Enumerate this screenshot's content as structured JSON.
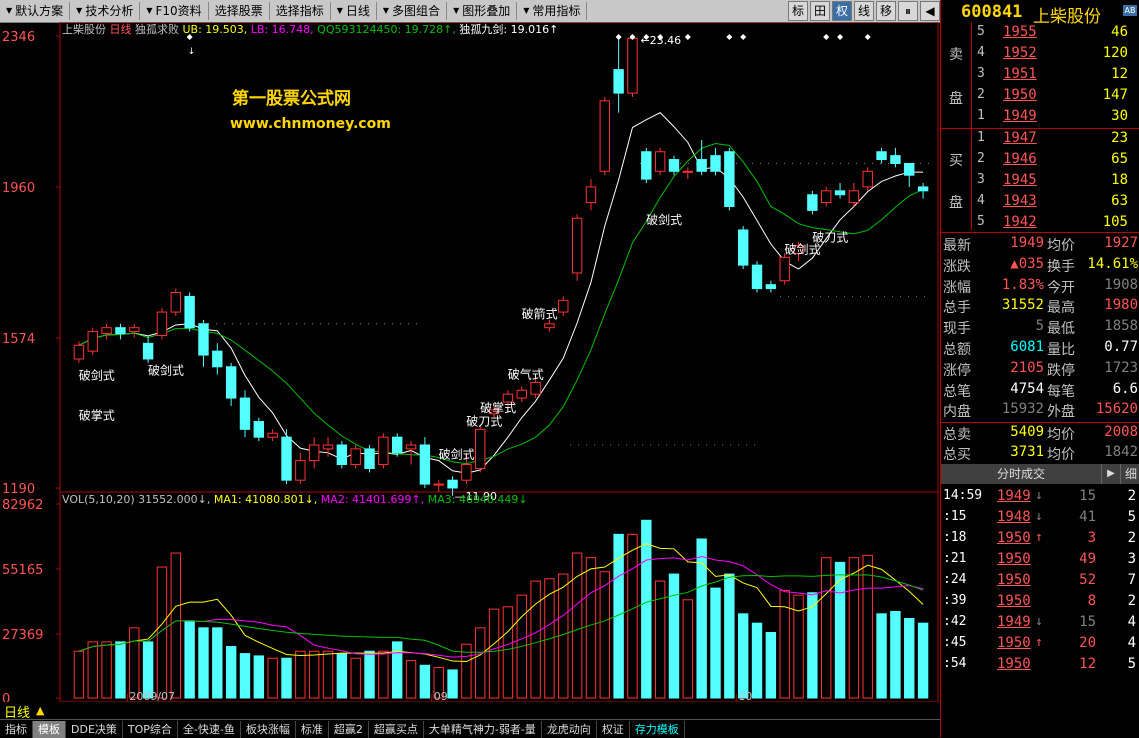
{
  "toolbar": {
    "items": [
      {
        "label": "默认方案",
        "tri": true
      },
      {
        "label": "技术分析",
        "tri": true
      },
      {
        "label": "F10资料",
        "tri": true
      },
      {
        "label": "选择股票",
        "tri": false
      },
      {
        "label": "选择指标",
        "tri": false
      },
      {
        "label": "日线",
        "tri": true
      },
      {
        "label": "多图组合",
        "tri": true
      },
      {
        "label": "图形叠加",
        "tri": true
      },
      {
        "label": "常用指标",
        "tri": true
      }
    ],
    "tools": [
      "标",
      "田",
      "权",
      "线",
      "移",
      "⏸",
      "◀"
    ]
  },
  "quote_head": {
    "code": "600841",
    "name": "上柴股份",
    "ab": "AB"
  },
  "chart_header": {
    "stock": "上柴股份",
    "period": "日线",
    "indicator": "独孤求败",
    "ub": "UB: 19.503,",
    "lb": "LB: 16.748,",
    "qq": "QQ593124450: 19.728↑,",
    "jiujian": "独孤九剑: 19.016↑"
  },
  "watermark": {
    "line1": "第一股票公式网",
    "line2": "www.chnmoney.com"
  },
  "price_axis": {
    "labels": [
      "2346",
      "1960",
      "1574",
      "1190"
    ]
  },
  "vol_header": {
    "name": "VOL(5,10,20)",
    "val": "31552.000↓,",
    "ma1": "MA1: 41080.801↓,",
    "ma2": "MA2: 41401.699↑,",
    "ma3": "MA3: 46940.449↓"
  },
  "vol_axis": {
    "labels": [
      "82962",
      "55165",
      "27369",
      "0"
    ]
  },
  "chart_data": {
    "type": "candlestick",
    "price_range": [
      1190,
      2346
    ],
    "candles": [
      [
        1520,
        1555,
        1510,
        1565
      ],
      [
        1540,
        1590,
        1530,
        1600
      ],
      [
        1585,
        1600,
        1570,
        1610
      ],
      [
        1600,
        1585,
        1570,
        1610
      ],
      [
        1590,
        1600,
        1575,
        1610
      ],
      [
        1560,
        1520,
        1510,
        1580
      ],
      [
        1580,
        1640,
        1570,
        1650
      ],
      [
        1640,
        1690,
        1630,
        1700
      ],
      [
        1680,
        1600,
        1590,
        1690
      ],
      [
        1610,
        1530,
        1500,
        1620
      ],
      [
        1540,
        1500,
        1480,
        1560
      ],
      [
        1500,
        1420,
        1400,
        1510
      ],
      [
        1420,
        1340,
        1320,
        1440
      ],
      [
        1360,
        1320,
        1310,
        1370
      ],
      [
        1320,
        1330,
        1310,
        1340
      ],
      [
        1320,
        1210,
        1200,
        1340
      ],
      [
        1210,
        1260,
        1200,
        1280
      ],
      [
        1260,
        1300,
        1240,
        1320
      ],
      [
        1290,
        1300,
        1270,
        1320
      ],
      [
        1300,
        1250,
        1240,
        1310
      ],
      [
        1250,
        1290,
        1240,
        1300
      ],
      [
        1290,
        1240,
        1230,
        1300
      ],
      [
        1250,
        1320,
        1240,
        1330
      ],
      [
        1320,
        1280,
        1270,
        1330
      ],
      [
        1290,
        1300,
        1250,
        1310
      ],
      [
        1300,
        1200,
        1190,
        1320
      ],
      [
        1200,
        1200,
        1180,
        1210
      ],
      [
        1210,
        1190,
        1170,
        1220
      ],
      [
        1210,
        1250,
        1200,
        1280
      ],
      [
        1240,
        1340,
        1230,
        1350
      ],
      [
        1380,
        1390,
        1370,
        1400
      ],
      [
        1410,
        1430,
        1390,
        1440
      ],
      [
        1420,
        1440,
        1410,
        1450
      ],
      [
        1430,
        1460,
        1420,
        1470
      ],
      [
        1600,
        1610,
        1590,
        1620
      ],
      [
        1640,
        1670,
        1630,
        1680
      ],
      [
        1740,
        1880,
        1720,
        1890
      ],
      [
        1920,
        1960,
        1900,
        1980
      ],
      [
        2000,
        2180,
        1990,
        2190
      ],
      [
        2260,
        2200,
        2150,
        2346
      ],
      [
        2200,
        2340,
        2190,
        2346
      ],
      [
        2050,
        1980,
        1970,
        2060
      ],
      [
        2000,
        2050,
        1990,
        2060
      ],
      [
        2030,
        2000,
        1990,
        2040
      ],
      [
        2000,
        2000,
        1980,
        2010
      ],
      [
        2030,
        2000,
        1990,
        2080
      ],
      [
        2040,
        2000,
        1990,
        2060
      ],
      [
        2050,
        1910,
        1900,
        2060
      ],
      [
        1850,
        1760,
        1750,
        1860
      ],
      [
        1760,
        1700,
        1690,
        1770
      ],
      [
        1710,
        1700,
        1690,
        1720
      ],
      [
        1720,
        1780,
        1710,
        1790
      ],
      [
        1790,
        1810,
        1770,
        1820
      ],
      [
        1940,
        1900,
        1890,
        1950
      ],
      [
        1920,
        1950,
        1910,
        1960
      ],
      [
        1950,
        1940,
        1930,
        1970
      ],
      [
        1920,
        1950,
        1910,
        1970
      ],
      [
        1960,
        2000,
        1950,
        2010
      ],
      [
        2050,
        2030,
        2020,
        2060
      ],
      [
        2040,
        2020,
        2010,
        2060
      ],
      [
        2020,
        1990,
        1960,
        2020
      ],
      [
        1960,
        1950,
        1930,
        1970
      ]
    ],
    "volumes": [
      20000,
      24000,
      24000,
      24000,
      30000,
      24000,
      56000,
      62000,
      33000,
      30000,
      30000,
      22000,
      19000,
      18000,
      17000,
      17000,
      20000,
      20000,
      20000,
      19000,
      17000,
      20000,
      20000,
      24000,
      16000,
      14000,
      13000,
      12000,
      23000,
      30000,
      38000,
      39000,
      44000,
      50000,
      51000,
      53000,
      62000,
      60000,
      54000,
      70000,
      70000,
      76000,
      50000,
      53000,
      42000,
      68000,
      47000,
      53000,
      36000,
      32000,
      28000,
      46000,
      44000,
      45000,
      60000,
      58000,
      60000,
      61000,
      36000,
      37000,
      34000,
      32000
    ],
    "candle_labels": [
      {
        "text": "破剑式",
        "i": 1,
        "price": 1468
      },
      {
        "text": "破掌式",
        "i": 1,
        "price": 1365
      },
      {
        "text": "破剑式",
        "i": 6,
        "price": 1480
      },
      {
        "text": "破剑式",
        "i": 27,
        "price": 1265
      },
      {
        "text": "破刀式",
        "i": 29,
        "price": 1350
      },
      {
        "text": "破掌式",
        "i": 30,
        "price": 1385
      },
      {
        "text": "破气式",
        "i": 32,
        "price": 1470
      },
      {
        "text": "破箭式",
        "i": 33,
        "price": 1625
      },
      {
        "text": "破剑式",
        "i": 42,
        "price": 1865
      },
      {
        "text": "破剑式",
        "i": 52,
        "price": 1790
      },
      {
        "text": "破刀式",
        "i": 54,
        "price": 1820
      }
    ],
    "low_label": "11.90",
    "high_label": "23.46",
    "x_labels": [
      {
        "text": "2009/07",
        "i": 4
      },
      {
        "text": "09",
        "i": 26
      },
      {
        "text": "10",
        "i": 48
      }
    ]
  },
  "day_label": "日线",
  "right_panel": {
    "sell": [
      {
        "n": "5",
        "p": "1955",
        "v": "46"
      },
      {
        "n": "4",
        "p": "1952",
        "v": "120"
      },
      {
        "n": "3",
        "p": "1951",
        "v": "12"
      },
      {
        "n": "2",
        "p": "1950",
        "v": "147"
      },
      {
        "n": "1",
        "p": "1949",
        "v": "30"
      }
    ],
    "buy": [
      {
        "n": "1",
        "p": "1947",
        "v": "23"
      },
      {
        "n": "2",
        "p": "1946",
        "v": "65"
      },
      {
        "n": "3",
        "p": "1945",
        "v": "18"
      },
      {
        "n": "4",
        "p": "1943",
        "v": "63"
      },
      {
        "n": "5",
        "p": "1942",
        "v": "105"
      }
    ],
    "sell_label": [
      "卖",
      "盘"
    ],
    "buy_label": [
      "买",
      "盘"
    ],
    "stats": [
      {
        "l1": "最新",
        "v1": "1949",
        "c1": "#ff5555",
        "l2": "均价",
        "v2": "1927",
        "c2": "#ff5555"
      },
      {
        "l1": "涨跌",
        "v1": "▲035",
        "c1": "#ff5555",
        "l2": "换手",
        "v2": "14.61%",
        "c2": "#ffff00"
      },
      {
        "l1": "涨幅",
        "v1": "1.83%",
        "c1": "#ff5555",
        "l2": "今开",
        "v2": "1908",
        "c2": "#808080"
      },
      {
        "l1": "总手",
        "v1": "31552",
        "c1": "#ffff00",
        "l2": "最高",
        "v2": "1980",
        "c2": "#ff5555"
      },
      {
        "l1": "现手",
        "v1": "5",
        "c1": "#808080",
        "l2": "最低",
        "v2": "1858",
        "c2": "#808080"
      },
      {
        "l1": "总额",
        "v1": "6081",
        "c1": "#00ffff",
        "l2": "量比",
        "v2": "0.77",
        "c2": "#ffffff"
      },
      {
        "l1": "涨停",
        "v1": "2105",
        "c1": "#ff5555",
        "l2": "跌停",
        "v2": "1723",
        "c2": "#808080"
      },
      {
        "l1": "总笔",
        "v1": "4754",
        "c1": "#ffffff",
        "l2": "每笔",
        "v2": "6.6",
        "c2": "#ffffff"
      },
      {
        "l1": "内盘",
        "v1": "15932",
        "c1": "#808080",
        "l2": "外盘",
        "v2": "15620",
        "c2": "#ff5555"
      }
    ],
    "totals": [
      {
        "l1": "总卖",
        "v1": "5409",
        "c1": "#ffff00",
        "l2": "均价",
        "v2": "2008",
        "c2": "#ff5555"
      },
      {
        "l1": "总买",
        "v1": "3731",
        "c1": "#ffff00",
        "l2": "均价",
        "v2": "1842",
        "c2": "#808080"
      }
    ],
    "ticks_title": "分时成交",
    "ticks_btn": "细",
    "ticks": [
      {
        "t": "14:59",
        "p": "1949",
        "a": "↓",
        "ac": "#808080",
        "v": "15",
        "vc": "#808080",
        "n": "2"
      },
      {
        "t": ":15",
        "p": "1948",
        "a": "↓",
        "ac": "#808080",
        "v": "41",
        "vc": "#808080",
        "n": "5"
      },
      {
        "t": ":18",
        "p": "1950",
        "a": "↑",
        "ac": "#ff5555",
        "v": "3",
        "vc": "#ff5555",
        "n": "2"
      },
      {
        "t": ":21",
        "p": "1950",
        "a": "",
        "ac": "#ff5555",
        "v": "49",
        "vc": "#ff5555",
        "n": "3"
      },
      {
        "t": ":24",
        "p": "1950",
        "a": "",
        "ac": "#ff5555",
        "v": "52",
        "vc": "#ff5555",
        "n": "7"
      },
      {
        "t": ":39",
        "p": "1950",
        "a": "",
        "ac": "#ff5555",
        "v": "8",
        "vc": "#ff5555",
        "n": "2"
      },
      {
        "t": ":42",
        "p": "1949",
        "a": "↓",
        "ac": "#808080",
        "v": "15",
        "vc": "#808080",
        "n": "4"
      },
      {
        "t": ":45",
        "p": "1950",
        "a": "↑",
        "ac": "#ff5555",
        "v": "20",
        "vc": "#ff5555",
        "n": "4"
      },
      {
        "t": ":54",
        "p": "1950",
        "a": "",
        "ac": "#ff5555",
        "v": "12",
        "vc": "#ff5555",
        "n": "5"
      }
    ]
  },
  "bottom_tabs": [
    "指标",
    "模板",
    "DDE决策",
    "TOP综合",
    "全-快速-鱼",
    "板块涨幅",
    "标准",
    "超赢2",
    "超赢买点",
    "大单精气神力-弱者-量",
    "龙虎动向",
    "权证",
    "存力模板"
  ],
  "colors": {
    "up": "#ff3232",
    "down": "#54ffff",
    "ma1": "#ffffff",
    "ma2": "#00c000",
    "vma1": "#ffff00",
    "vma2": "#ff00ff",
    "vma3": "#00c000"
  }
}
